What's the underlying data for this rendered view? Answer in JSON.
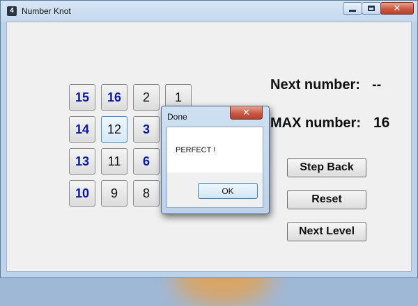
{
  "window": {
    "icon_text": "4",
    "title": "Number Knot"
  },
  "grid": {
    "tiles": [
      {
        "value": "15",
        "style": "blue"
      },
      {
        "value": "16",
        "style": "blue"
      },
      {
        "value": "2",
        "style": "plain"
      },
      {
        "value": "1",
        "style": "plain"
      },
      {
        "value": "14",
        "style": "blue"
      },
      {
        "value": "12",
        "style": "selected"
      },
      {
        "value": "3",
        "style": "blue"
      },
      {
        "value": "",
        "style": "hidden"
      },
      {
        "value": "13",
        "style": "blue"
      },
      {
        "value": "11",
        "style": "plain"
      },
      {
        "value": "6",
        "style": "blue"
      },
      {
        "value": "",
        "style": "hidden"
      },
      {
        "value": "10",
        "style": "blue"
      },
      {
        "value": "9",
        "style": "plain"
      },
      {
        "value": "8",
        "style": "plain"
      },
      {
        "value": "",
        "style": "hidden"
      }
    ]
  },
  "info": {
    "next_label": "Next number:",
    "next_value": "--",
    "max_label": "MAX number:",
    "max_value": "16"
  },
  "buttons": {
    "step_back": "Step Back",
    "reset": "Reset",
    "next_level": "Next Level"
  },
  "dialog": {
    "title": "Done",
    "message": "PERFECT !",
    "ok_label": "OK"
  },
  "colors": {
    "highlight_number": "#0a1aa8",
    "close_button": "#c75a44"
  }
}
